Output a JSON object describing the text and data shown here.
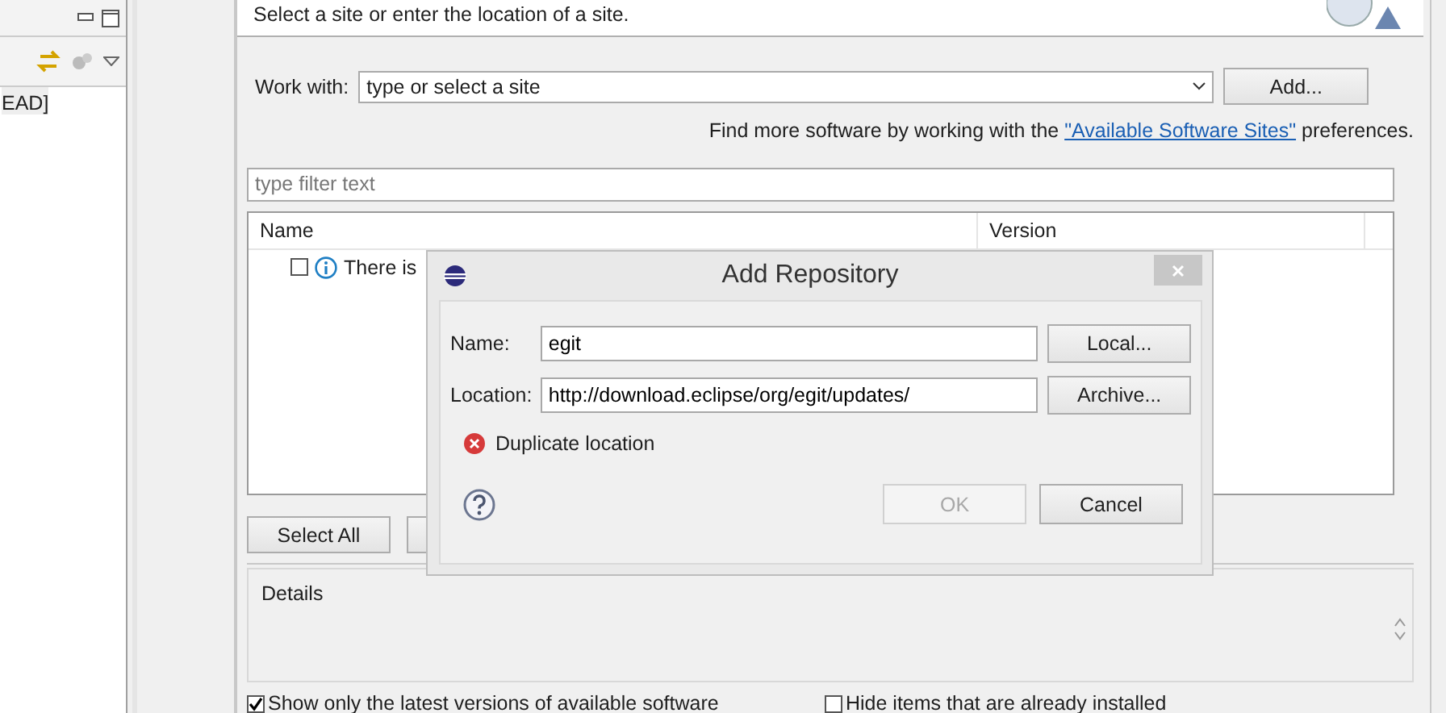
{
  "side_panel": {
    "tree_item": "EAD]"
  },
  "wizard": {
    "header": "Select a site or enter the location of a site.",
    "work_with": {
      "label": "Work with:",
      "value": "type or select a site"
    },
    "add_button": "Add...",
    "hint": {
      "before": "Find more software by working with the ",
      "link": "\"Available Software Sites\"",
      "after": " preferences."
    },
    "filter": {
      "placeholder": "type filter text"
    },
    "table": {
      "columns": [
        "Name",
        "Version"
      ],
      "rows": [
        {
          "name": "There is",
          "checked": false
        }
      ]
    },
    "buttons": [
      "Select All"
    ],
    "details": {
      "title": "Details"
    },
    "options": [
      {
        "label": "Show only the latest versions of available software",
        "checked": true
      },
      {
        "label": "Hide items that are already installed",
        "checked": false
      }
    ]
  },
  "dialog": {
    "title": "Add Repository",
    "fields": [
      {
        "label": "Name:",
        "value": "egit",
        "button": "Local..."
      },
      {
        "label": "Location:",
        "value": "http://download.eclipse/org/egit/updates/",
        "button": "Archive..."
      }
    ],
    "error": "Duplicate location",
    "buttons": [
      {
        "label": "OK",
        "disabled": true
      },
      {
        "label": "Cancel",
        "disabled": false
      }
    ]
  }
}
